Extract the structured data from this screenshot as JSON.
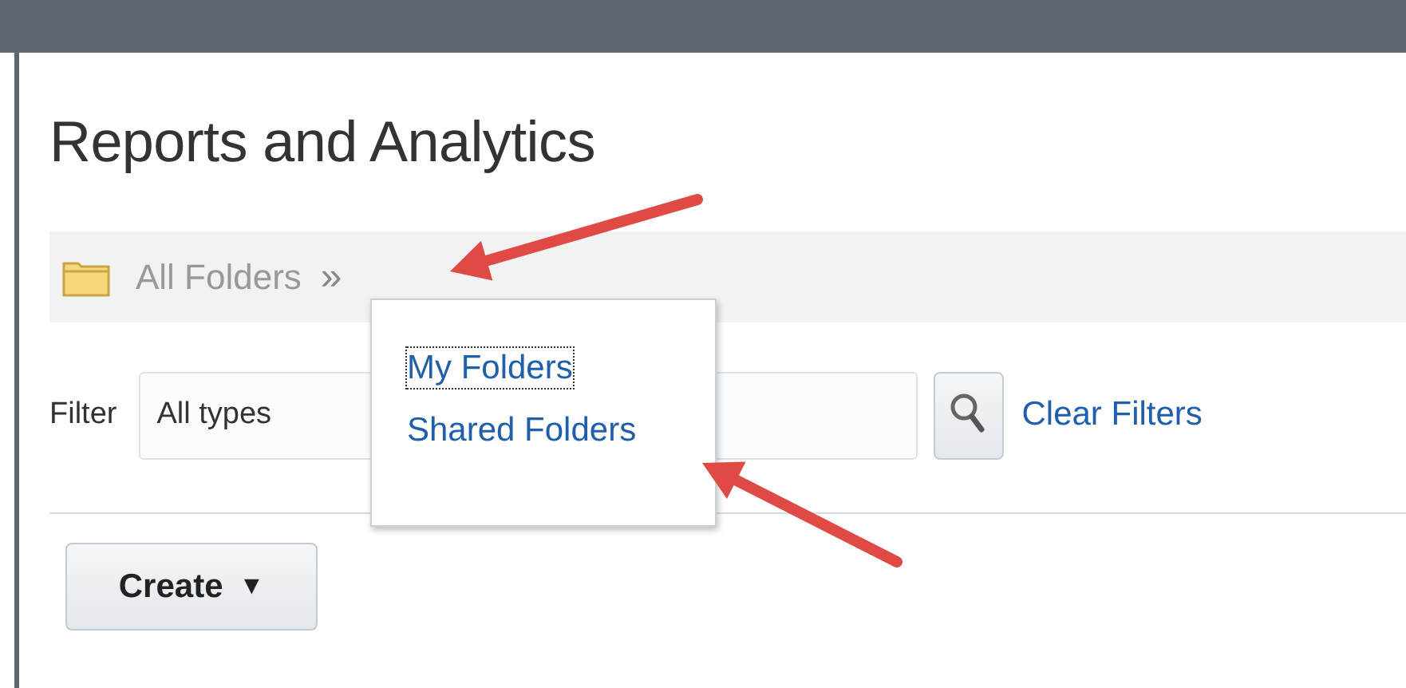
{
  "page": {
    "title": "Reports and Analytics"
  },
  "breadcrumb": {
    "label": "All Folders",
    "separator": "»"
  },
  "folder_menu": {
    "items": [
      {
        "label": "My Folders",
        "focused": true
      },
      {
        "label": "Shared Folders",
        "focused": false
      }
    ]
  },
  "filter": {
    "label": "Filter",
    "value": "All types",
    "clear_link": "Clear Filters"
  },
  "create_button": {
    "label": "Create",
    "caret": "▼"
  },
  "annotations": [
    {
      "kind": "arrow"
    },
    {
      "kind": "arrow"
    }
  ]
}
